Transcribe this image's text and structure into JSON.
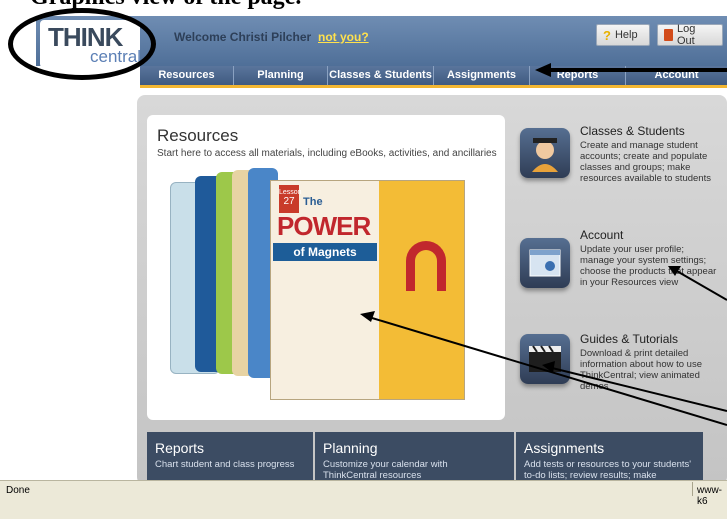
{
  "doc": {
    "heading": "Graphics view of the page."
  },
  "header": {
    "logo_think": "THINK",
    "logo_central": "central",
    "welcome": "Welcome Christi Pilcher",
    "not_you": "not you?",
    "help": "Help",
    "logout": "Log Out"
  },
  "nav": {
    "items": [
      {
        "label": "Resources"
      },
      {
        "label": "Planning"
      },
      {
        "label": "Classes & Students"
      },
      {
        "label": "Assignments"
      },
      {
        "label": "Reports"
      },
      {
        "label": "Account"
      }
    ]
  },
  "resources": {
    "title": "Resources",
    "desc": "Start here to access all materials, including eBooks, activities, and ancillaries",
    "book": {
      "lesson_label": "Lesson",
      "lesson_num": "27",
      "the": "The",
      "power": "POWER",
      "of_magnets": "of Magnets"
    }
  },
  "side": {
    "classes": {
      "title": "Classes & Students",
      "desc": "Create and manage student accounts; create and populate classes and groups; make resources available to students"
    },
    "account": {
      "title": "Account",
      "desc": "Update your user profile; manage your system settings; choose the products that appear in your Resources view"
    },
    "guides": {
      "title": "Guides & Tutorials",
      "desc": "Download & print detailed information about how to use ThinkCentral; view animated demos"
    }
  },
  "bottom": {
    "reports": {
      "title": "Reports",
      "desc": "Chart student and class progress"
    },
    "planning": {
      "title": "Planning",
      "desc": "Customize your calendar with ThinkCentral resources"
    },
    "assignments": {
      "title": "Assignments",
      "desc": "Add tests or resources to your students' to-do lists; review results; make prescriptions"
    }
  },
  "status": {
    "text": "Done",
    "url": "www-k6"
  },
  "colors": {
    "accent": "#f2b632",
    "nav": "#4a6790",
    "panel": "#3c4c63"
  }
}
